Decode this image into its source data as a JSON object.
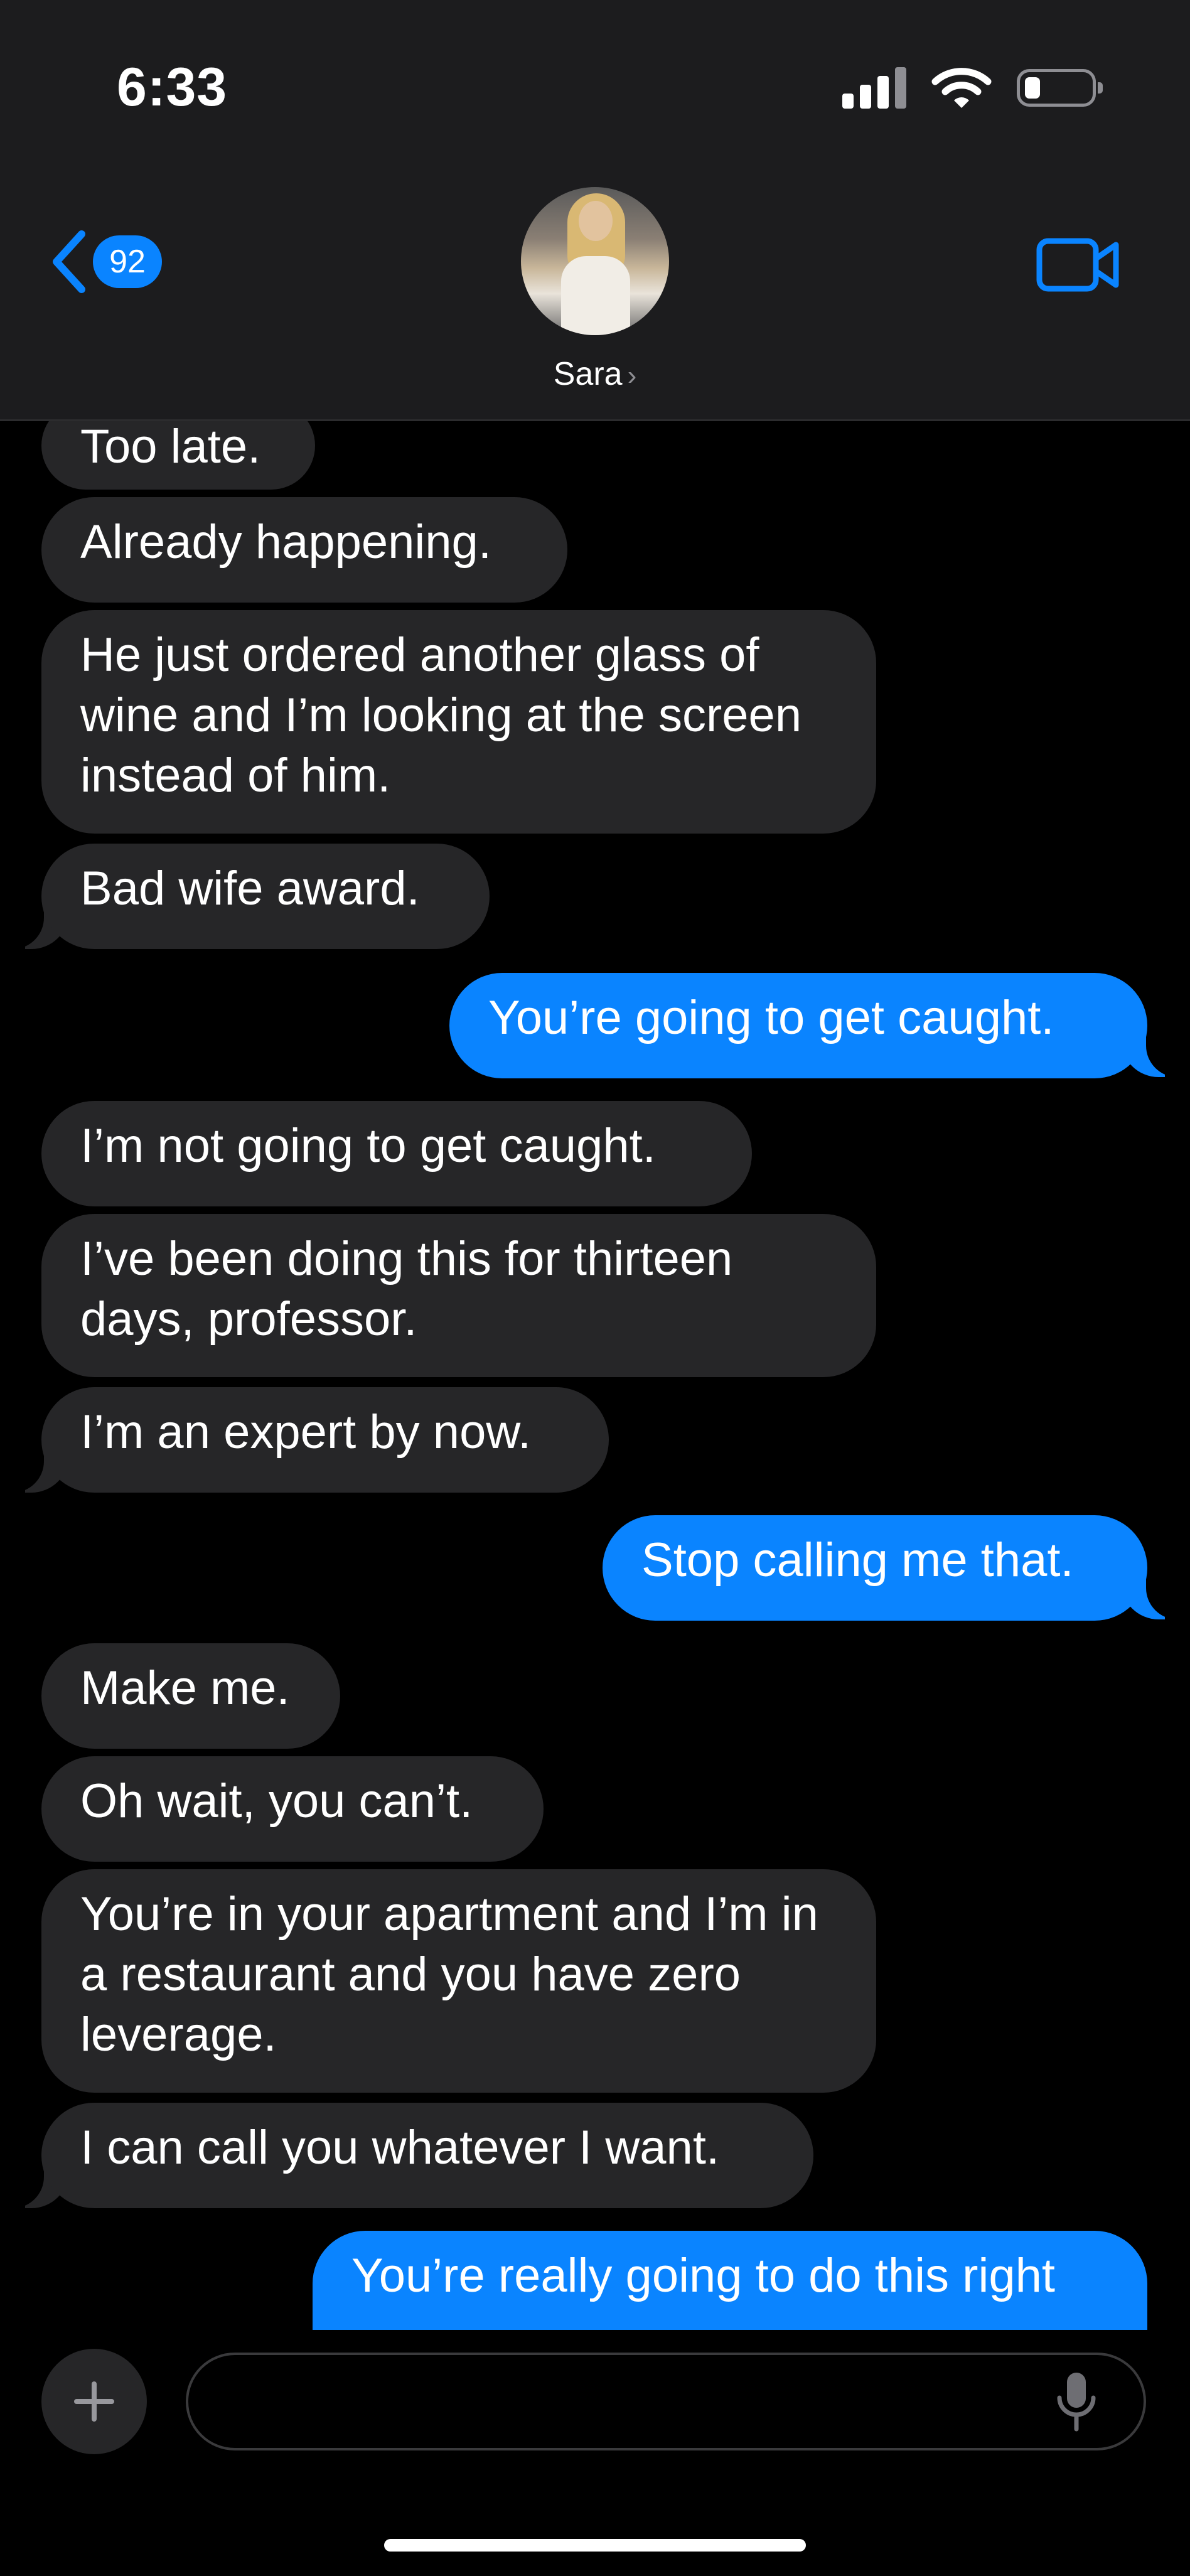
{
  "status_bar": {
    "time": "6:33"
  },
  "header": {
    "unread_count": "92",
    "contact_name": "Sara"
  },
  "messages": [
    {
      "from": "them",
      "text": "Too late."
    },
    {
      "from": "them",
      "text": "Already happening."
    },
    {
      "from": "them",
      "text": "He just ordered another glass of wine and I’m looking at the screen instead of him."
    },
    {
      "from": "them",
      "text": "Bad wife award."
    },
    {
      "from": "me",
      "text": "You’re going to get caught."
    },
    {
      "from": "them",
      "text": "I’m not going to get caught."
    },
    {
      "from": "them",
      "text": "I’ve been doing this for thirteen days, professor."
    },
    {
      "from": "them",
      "text": "I’m an expert by now."
    },
    {
      "from": "me",
      "text": "Stop calling me that."
    },
    {
      "from": "them",
      "text": "Make me."
    },
    {
      "from": "them",
      "text": "Oh wait, you can’t."
    },
    {
      "from": "them",
      "text": "You’re in your apartment and I’m in a restaurant and you have zero leverage."
    },
    {
      "from": "them",
      "text": "I can call you whatever I want."
    },
    {
      "from": "me",
      "text": "You’re really going to do this right"
    }
  ],
  "composer": {
    "value": "",
    "placeholder": ""
  },
  "colors": {
    "outgoing": "#0a84ff",
    "incoming": "#262628",
    "header_bg": "#1c1c1e",
    "background": "#000000"
  },
  "icons": [
    "chevron-left-icon",
    "video-camera-icon",
    "plus-icon",
    "microphone-icon",
    "cellular-signal-icon",
    "wifi-icon",
    "battery-icon"
  ]
}
